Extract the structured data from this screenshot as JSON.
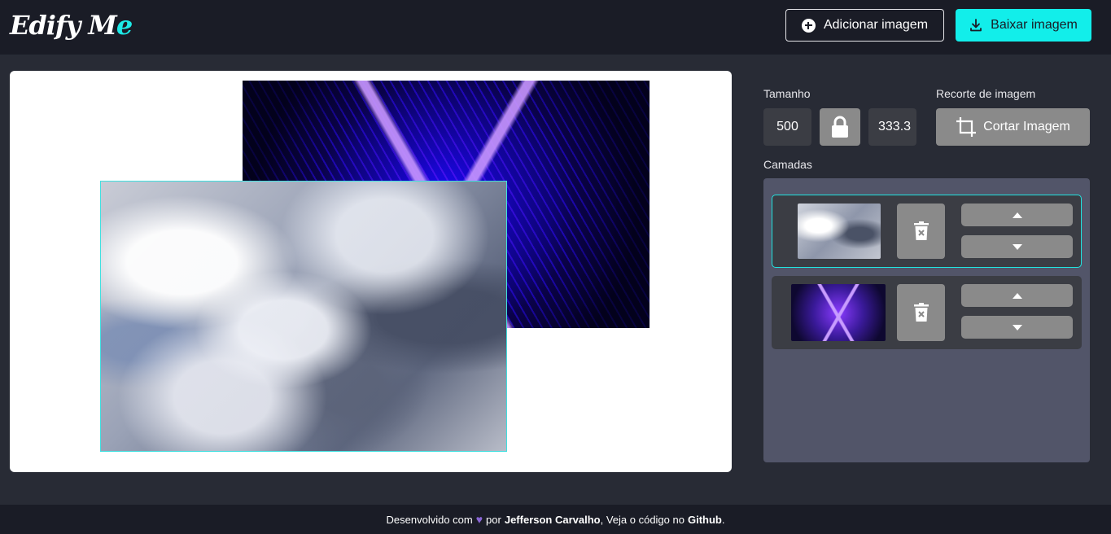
{
  "app": {
    "logo_main": "Edify M",
    "logo_accent": "e"
  },
  "header": {
    "add_label": "Adicionar imagem",
    "download_label": "Baixar imagem"
  },
  "controls": {
    "size_label": "Tamanho",
    "width_value": "500",
    "height_value": "333.3",
    "crop_section_label": "Recorte de imagem",
    "crop_button_label": "Cortar Imagem",
    "layers_label": "Camadas"
  },
  "layers": [
    {
      "name": "clouds",
      "selected": true
    },
    {
      "name": "purple-tunnel",
      "selected": false
    }
  ],
  "footer": {
    "prefix": "Desenvolvido com",
    "heart": "♥",
    "by": "por",
    "author": "Jefferson Carvalho",
    "middle": ", Veja o código no",
    "link": "Github",
    "suffix": "."
  },
  "colors": {
    "accent": "#12eeea",
    "header_bg": "#1a1c26",
    "page_bg": "#282b35",
    "panel_bg": "#525569",
    "button_gray": "#8a8a8a"
  }
}
